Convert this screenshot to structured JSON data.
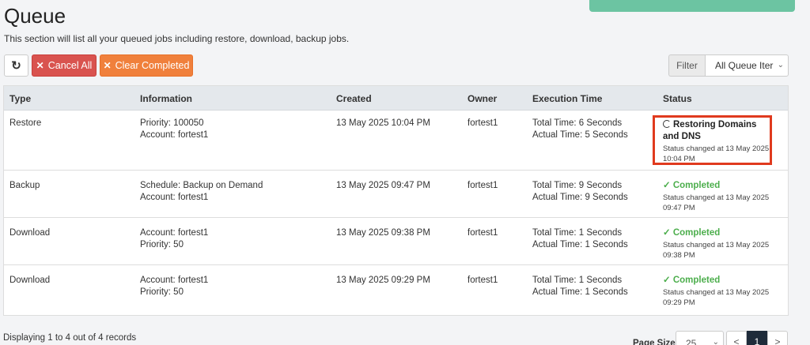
{
  "page": {
    "title": "Queue",
    "description": "This section will list all your queued jobs including restore, download, backup jobs."
  },
  "toolbar": {
    "refresh_icon": "refresh-icon",
    "cancel_all_label": "Cancel All",
    "clear_completed_label": "Clear Completed",
    "filter_label": "Filter",
    "filter_value": "All Queue Iter"
  },
  "table": {
    "headers": {
      "type": "Type",
      "information": "Information",
      "created": "Created",
      "owner": "Owner",
      "execution_time": "Execution Time",
      "status": "Status"
    },
    "rows": [
      {
        "type": "Restore",
        "info_line1": "Priority: 100050",
        "info_line2": "Account: fortest1",
        "created": "13 May 2025 10:04 PM",
        "owner": "fortest1",
        "total_time": "Total Time: 6 Seconds",
        "actual_time": "Actual Time: 5 Seconds",
        "status": "Restoring Domains and DNS",
        "status_note": "Status changed at 13 May 2025 10:04 PM"
      },
      {
        "type": "Backup",
        "info_line1": "Schedule: Backup on Demand",
        "info_line2": "Account: fortest1",
        "created": "13 May 2025 09:47 PM",
        "owner": "fortest1",
        "total_time": "Total Time: 9 Seconds",
        "actual_time": "Actual Time: 9 Seconds",
        "status": "Completed",
        "status_note": "Status changed at 13 May 2025 09:47 PM"
      },
      {
        "type": "Download",
        "info_line1": "Account: fortest1",
        "info_line2": "Priority: 50",
        "created": "13 May 2025 09:38 PM",
        "owner": "fortest1",
        "total_time": "Total Time: 1 Seconds",
        "actual_time": "Actual Time: 1 Seconds",
        "status": "Completed",
        "status_note": "Status changed at 13 May 2025 09:38 PM"
      },
      {
        "type": "Download",
        "info_line1": "Account: fortest1",
        "info_line2": "Priority: 50",
        "created": "13 May 2025 09:29 PM",
        "owner": "fortest1",
        "total_time": "Total Time: 1 Seconds",
        "actual_time": "Actual Time: 1 Seconds",
        "status": "Completed",
        "status_note": "Status changed at 13 May 2025 09:29 PM"
      }
    ]
  },
  "footer": {
    "display_text": "Displaying 1 to 4 out of 4 records",
    "page_size_label": "Page Size",
    "page_size_value": "25",
    "prev": "<",
    "current_page": "1",
    "next": ">"
  },
  "colors": {
    "cancel": "#d9534f",
    "clear": "#f0803c",
    "completed": "#4cae4c",
    "highlight": "#e03a1e"
  }
}
